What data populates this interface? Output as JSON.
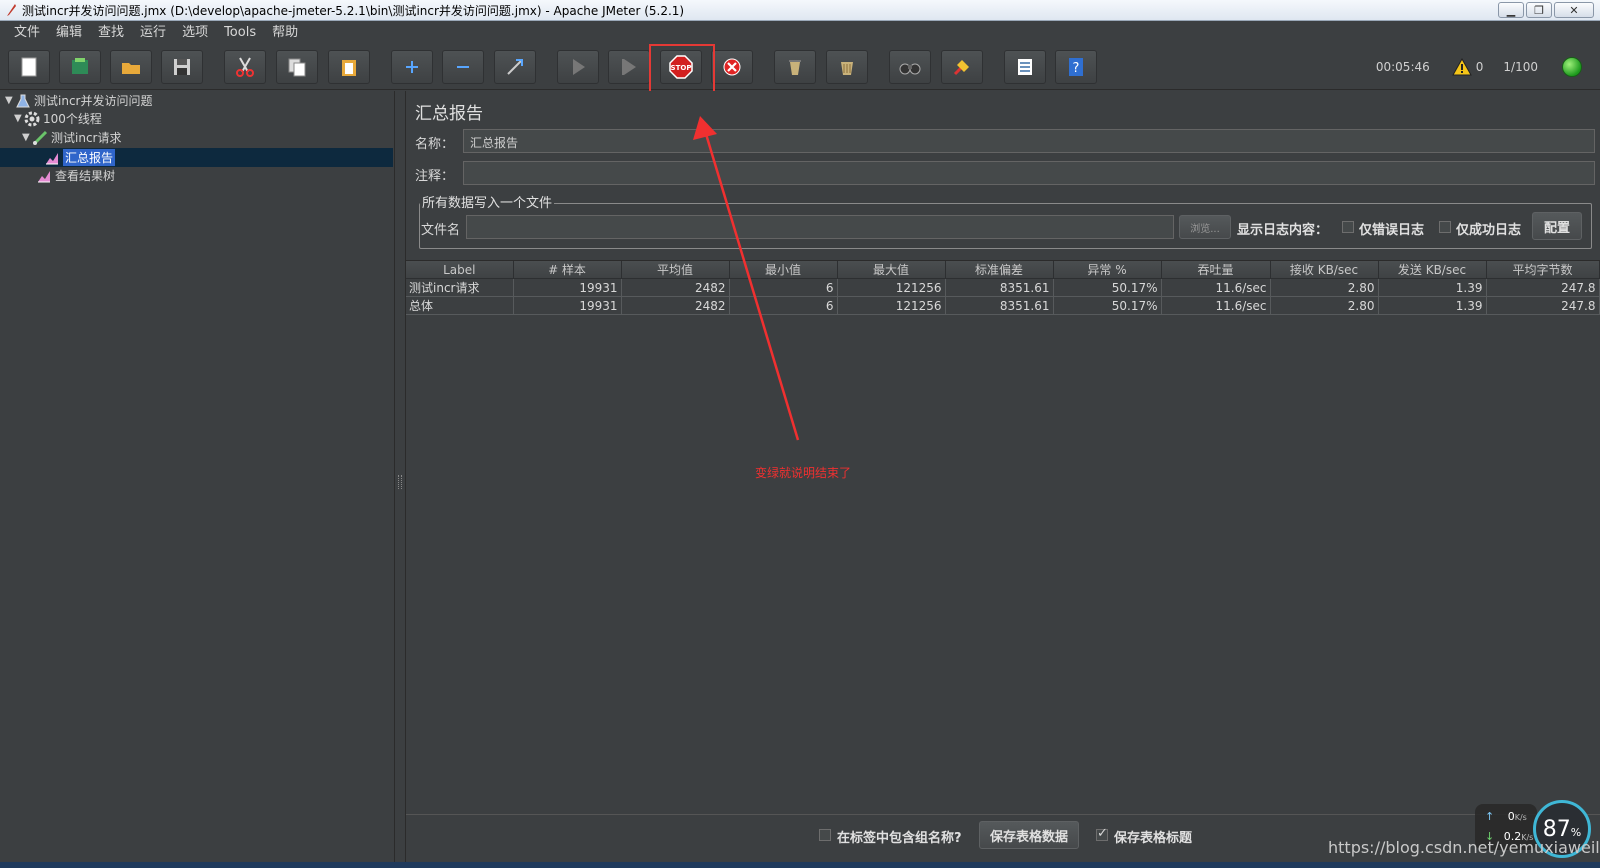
{
  "window": {
    "title": "测试incr并发访问问题.jmx (D:\\develop\\apache-jmeter-5.2.1\\bin\\测试incr并发访问问题.jmx) - Apache JMeter (5.2.1)"
  },
  "menu": [
    "文件",
    "编辑",
    "查找",
    "运行",
    "选项",
    "Tools",
    "帮助"
  ],
  "toolbar": {
    "icons": [
      "new-icon",
      "templates-icon",
      "open-icon",
      "save-icon",
      "cut-icon",
      "copy-icon",
      "paste-icon",
      "expand-icon",
      "collapse-icon",
      "toggle-icon",
      "start-icon",
      "start-no-pause-icon",
      "stop-icon",
      "shutdown-icon",
      "clear-icon",
      "clear-all-icon",
      "search-icon",
      "reset-search-icon",
      "function-helper-icon",
      "help-icon"
    ],
    "stop_label": "STOP"
  },
  "status": {
    "elapsed": "00:05:46",
    "warnings": "0",
    "threads": "1/100",
    "led_color": "#2fb52f"
  },
  "tree": {
    "items": [
      {
        "label": "测试incr并发访问问题",
        "icon": "test-plan-icon"
      },
      {
        "label": "100个线程",
        "icon": "thread-group-icon"
      },
      {
        "label": "测试incr请求",
        "icon": "sampler-icon"
      },
      {
        "label": "汇总报告",
        "icon": "listener-icon"
      },
      {
        "label": "查看结果树",
        "icon": "listener-icon"
      }
    ]
  },
  "panel": {
    "title": "汇总报告",
    "name_label": "名称：",
    "name_value": "汇总报告",
    "comment_label": "注释：",
    "comment_value": "",
    "file_group_title": "所有数据写入一个文件",
    "filename_label": "文件名",
    "filename_value": "",
    "browse_label": "浏览...",
    "log_label": "显示日志内容：",
    "errors_only_label": "仅错误日志",
    "success_only_label": "仅成功日志",
    "configure_label": "配置"
  },
  "table": {
    "headers": [
      "Label",
      "# 样本",
      "平均值",
      "最小值",
      "最大值",
      "标准偏差",
      "异常 %",
      "吞吐量",
      "接收 KB/sec",
      "发送 KB/sec",
      "平均字节数"
    ],
    "rows": [
      [
        "测试incr请求",
        "19931",
        "2482",
        "6",
        "121256",
        "8351.61",
        "50.17%",
        "11.6/sec",
        "2.80",
        "1.39",
        "247.8"
      ],
      [
        "总体",
        "19931",
        "2482",
        "6",
        "121256",
        "8351.61",
        "50.17%",
        "11.6/sec",
        "2.80",
        "1.39",
        "247.8"
      ]
    ]
  },
  "bottom": {
    "include_group_label": "在标签中包含组名称?",
    "save_table_label": "保存表格数据",
    "save_header_label": "保存表格标题",
    "save_header_checked": true
  },
  "annotation": {
    "text": "变绿就说明结束了",
    "color": "#f03030"
  },
  "widget": {
    "up_value": "0",
    "up_unit": "K/s",
    "down_value": "0.2",
    "down_unit": "K/s",
    "percent": "87",
    "percent_sign": "%"
  },
  "watermark": "https://blog.csdn.net/yemuxiaweiliang"
}
